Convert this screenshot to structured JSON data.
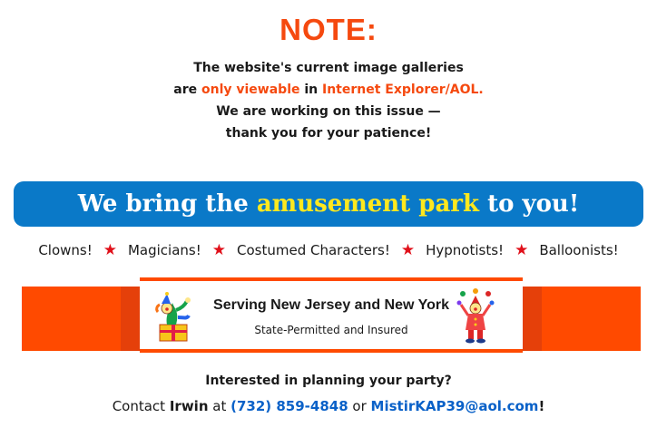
{
  "note": {
    "title": "NOTE:",
    "line1": "The website's current image galleries",
    "line2_pre": "are ",
    "line2_hl1": "only viewable",
    "line2_mid": " in ",
    "line2_hl2": "Internet Explorer/AOL.",
    "line3": "We are working on this issue —",
    "line4": "thank you for your patience!"
  },
  "banner": {
    "pre": "We bring the ",
    "highlight": "amusement park",
    "post": " to you!"
  },
  "services": [
    "Clowns!",
    "Magicians!",
    "Costumed Characters!",
    "Hypnotists!",
    "Balloonists!"
  ],
  "serving": {
    "title": "Serving New Jersey and New York",
    "subtitle": "State-Permitted and Insured"
  },
  "contact": {
    "question": "Interested in planning your party?",
    "pre": "Contact ",
    "name": "Irwin",
    "at": " at ",
    "phone": "(732) 859-4848",
    "or": " or ",
    "email": "MistirKAP39@aol.com",
    "end": "!"
  },
  "colors": {
    "accent_orange": "#f5490f",
    "banner_blue": "#0a79c8",
    "highlight_yellow": "#ffe81e",
    "star_red": "#e0101a",
    "link_blue": "#0a61c8"
  }
}
